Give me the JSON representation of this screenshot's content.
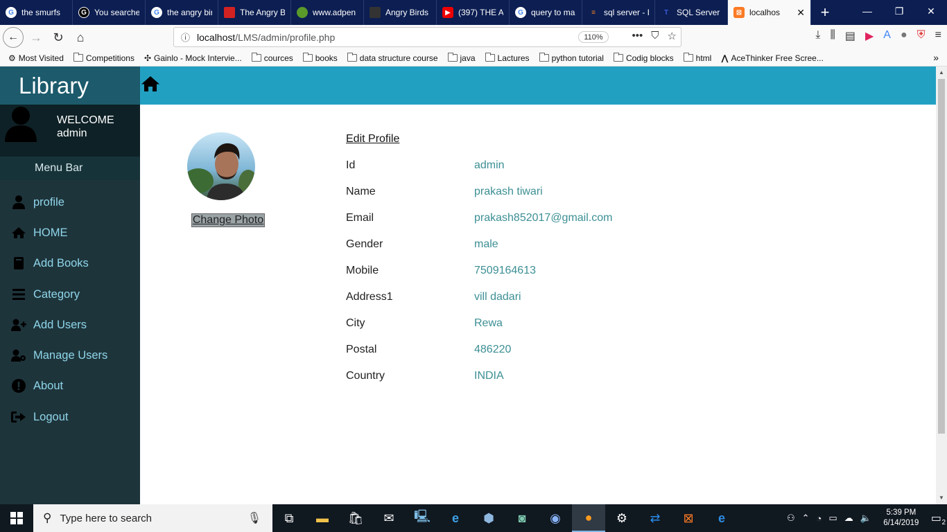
{
  "browser": {
    "tabs": [
      {
        "title": "the smurfs",
        "icon": "google-icon"
      },
      {
        "title": "You searched",
        "icon": "g-icon"
      },
      {
        "title": "the angry birds",
        "icon": "google-icon"
      },
      {
        "title": "The Angry B",
        "icon": "red-square-icon"
      },
      {
        "title": "www.adpen",
        "icon": "frog-icon"
      },
      {
        "title": "Angry Birds",
        "icon": "clapper-icon"
      },
      {
        "title": "(397) THE A",
        "icon": "youtube-icon"
      },
      {
        "title": "query to ma",
        "icon": "google-icon"
      },
      {
        "title": "sql server - I",
        "icon": "stackoverflow-icon"
      },
      {
        "title": "SQL Server",
        "icon": "t-icon"
      },
      {
        "title": "localhos",
        "icon": "xampp-icon",
        "active": true
      }
    ],
    "url_host": "localhost",
    "url_path": "/LMS/admin/profile.php",
    "zoom": "110%",
    "bookmarks": [
      {
        "label": "Most Visited",
        "icon": "gear-icon"
      },
      {
        "label": "Competitions",
        "icon": "folder-icon"
      },
      {
        "label": "Gainlo - Mock Intervie...",
        "icon": "gainlo-icon"
      },
      {
        "label": "cources",
        "icon": "folder-icon"
      },
      {
        "label": "books",
        "icon": "folder-icon"
      },
      {
        "label": "data structure course",
        "icon": "folder-icon"
      },
      {
        "label": "java",
        "icon": "folder-icon"
      },
      {
        "label": "Lactures",
        "icon": "folder-icon"
      },
      {
        "label": "python tutorial",
        "icon": "folder-icon"
      },
      {
        "label": "Codig blocks",
        "icon": "folder-icon"
      },
      {
        "label": "html",
        "icon": "folder-icon"
      },
      {
        "label": "AceThinker Free Scree...",
        "icon": "acethinker-icon"
      }
    ]
  },
  "sidebar": {
    "brand": "Library",
    "welcome": "WELCOME",
    "username": "admin",
    "menu_bar": "Menu Bar",
    "items": [
      {
        "label": "profile",
        "icon": "user-icon"
      },
      {
        "label": "HOME",
        "icon": "home-icon"
      },
      {
        "label": "Add Books",
        "icon": "book-icon"
      },
      {
        "label": "Category",
        "icon": "bars-icon"
      },
      {
        "label": "Add Users",
        "icon": "user-plus-icon"
      },
      {
        "label": "Manage Users",
        "icon": "user-gear-icon"
      },
      {
        "label": "About",
        "icon": "info-icon"
      },
      {
        "label": "Logout",
        "icon": "logout-icon"
      }
    ]
  },
  "profile": {
    "change_photo": "Change Photo",
    "edit_profile": "Edit Profile",
    "fields": [
      {
        "label": "Id",
        "value": "admin"
      },
      {
        "label": "Name",
        "value": "prakash tiwari"
      },
      {
        "label": "Email",
        "value": "prakash852017@gmail.com"
      },
      {
        "label": "Gender",
        "value": "male"
      },
      {
        "label": "Mobile",
        "value": "7509164613"
      },
      {
        "label": "Address1",
        "value": "vill dadari"
      },
      {
        "label": "City",
        "value": "Rewa"
      },
      {
        "label": "Postal",
        "value": "486220"
      },
      {
        "label": "Country",
        "value": "INDIA"
      }
    ]
  },
  "taskbar": {
    "search_placeholder": "Type here to search",
    "time": "5:39 PM",
    "date": "6/14/2019",
    "notification_count": "2"
  },
  "colors": {
    "sidebar_bg": "#1e343b",
    "header_bg": "#22a0c2",
    "value_text": "#3c8f94",
    "sidebar_link": "#8fd6ea"
  }
}
